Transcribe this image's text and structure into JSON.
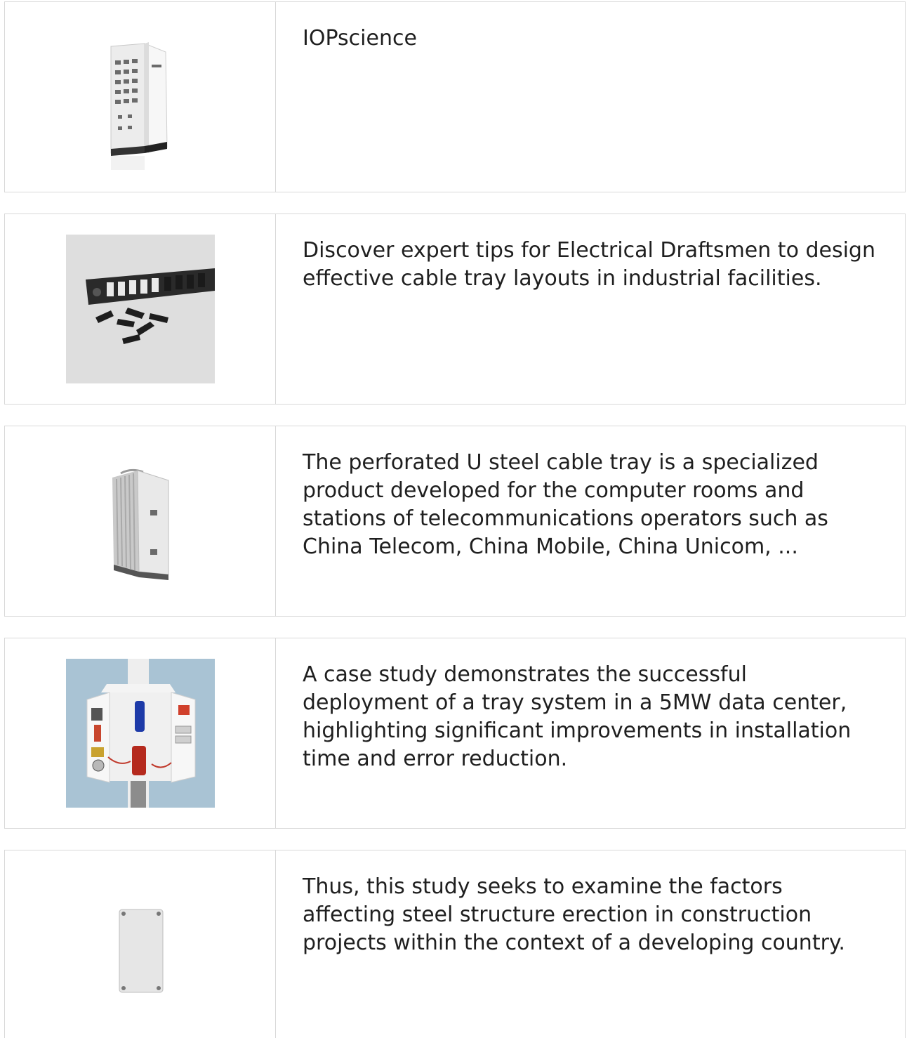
{
  "items": [
    {
      "text": "IOPscience",
      "image": "white-electrical-cabinet-image"
    },
    {
      "text": "Discover expert tips for Electrical Draftsmen to design effective cable tray layouts in industrial facilities.",
      "image": "black-cable-tray-panel-image"
    },
    {
      "text": "The perforated U steel cable tray is a specialized product developed for the computer rooms and stations of telecommunications operators such as China Telecom, China Mobile, China Unicom, ...",
      "image": "outdoor-telecom-cabinet-image"
    },
    {
      "text": "A case study demonstrates the successful deployment of a tray system in a 5MW data center, highlighting significant improvements in installation time and error reduction.",
      "image": "pole-mounted-electrical-box-image"
    },
    {
      "text": "Thus, this study seeks to examine the factors affecting steel structure erection in construction projects within the context of a developing country.",
      "image": "grey-junction-box-image"
    }
  ]
}
